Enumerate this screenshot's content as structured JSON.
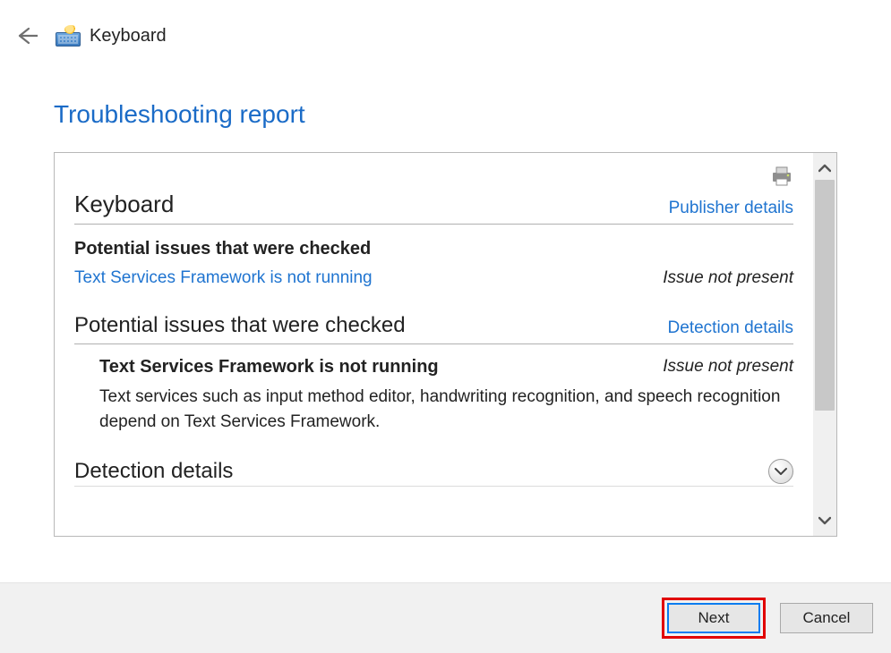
{
  "header": {
    "title": "Keyboard"
  },
  "page_title": "Troubleshooting report",
  "report": {
    "section1": {
      "title": "Keyboard",
      "publisher_link": "Publisher details"
    },
    "checked_heading": "Potential issues that were checked",
    "issue1": {
      "name": "Text Services Framework is not running",
      "status": "Issue not present"
    },
    "section2": {
      "title": "Potential issues that were checked",
      "detection_link": "Detection details"
    },
    "detail": {
      "title": "Text Services Framework is not running",
      "status": "Issue not present",
      "desc": "Text services such as input method editor, handwriting recognition, and speech recognition depend on Text Services Framework."
    },
    "detection_heading": "Detection details"
  },
  "buttons": {
    "next": "Next",
    "cancel": "Cancel"
  }
}
